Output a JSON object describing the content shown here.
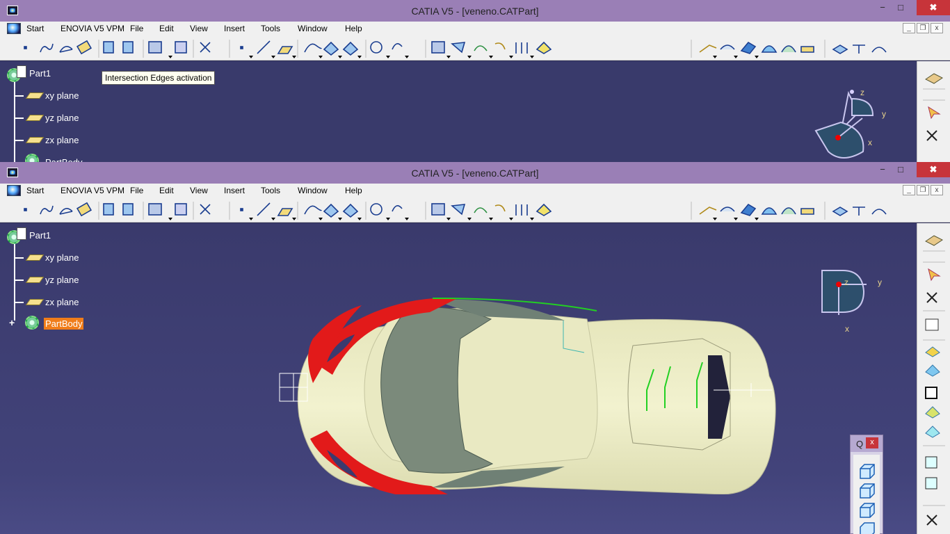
{
  "window": {
    "title": "CATIA V5 - [veneno.CATPart]",
    "min_glyph": "−",
    "max_glyph": "□",
    "close_glyph": "✖"
  },
  "menu": {
    "items": [
      "Start",
      "ENOVIA V5 VPM",
      "File",
      "Edit",
      "View",
      "Insert",
      "Tools",
      "Window",
      "Help"
    ],
    "mdi_min": "_",
    "mdi_restore": "❐",
    "mdi_close": "x"
  },
  "tree": {
    "root": "Part1",
    "planes": [
      "xy plane",
      "yz plane",
      "zx plane"
    ],
    "body": "PartBody"
  },
  "compass": {
    "z": "z",
    "y": "y",
    "x": "x"
  },
  "tooltip": "Intersection Edges activation",
  "quick_panel": {
    "label": "Q",
    "close": "x"
  },
  "colors": {
    "titlebar": "#9a7fb6",
    "viewport": "#3a3a6e",
    "car_body": "#e8e8bf",
    "car_red": "#e21a1a",
    "highlight": "#f07d1a",
    "close_button": "#c7343a"
  }
}
